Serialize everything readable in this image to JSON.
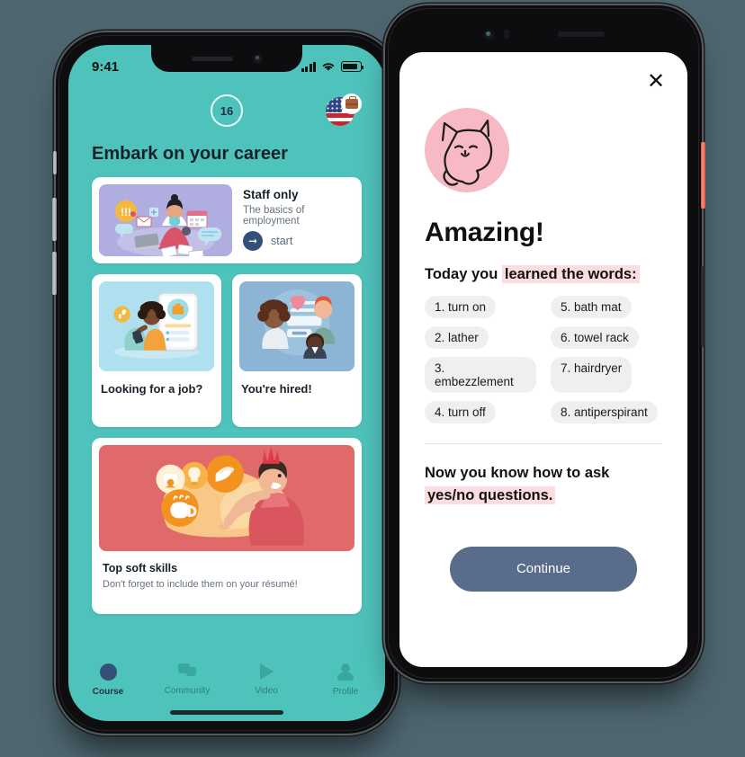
{
  "left_phone": {
    "status_bar": {
      "time": "9:41",
      "signal_icon": "cellular-bars-icon",
      "wifi_icon": "wifi-icon",
      "battery_icon": "battery-icon"
    },
    "header": {
      "streak_count": "16",
      "flag_icon": "us-flag-icon",
      "badge_icon": "briefcase-icon"
    },
    "page_title": "Embark on your career",
    "featured_card": {
      "title": "Staff only",
      "subtitle": "The basics of employment",
      "start_label": "start",
      "start_icon": "arrow-right-icon",
      "thumb_color": "#b0aee0"
    },
    "cards": [
      {
        "title": "Looking for a job?",
        "thumb_color": "#aee0ef"
      },
      {
        "title": "You're hired!",
        "thumb_color": "#8cb4d4"
      }
    ],
    "promo_card": {
      "title": "Top soft skills",
      "subtitle": "Don't forget to include them on your résumé!",
      "thumb_color": "#e06a6a"
    },
    "tabs": [
      {
        "label": "Course",
        "icon": "circle-icon",
        "active": true
      },
      {
        "label": "Community",
        "icon": "chat-bubbles-icon",
        "active": false
      },
      {
        "label": "Video",
        "icon": "play-icon",
        "active": false
      },
      {
        "label": "Profile",
        "icon": "person-icon",
        "active": false
      }
    ],
    "theme": {
      "background": "#4ec3bb",
      "accent": "#33507a",
      "inactive_tab": "#39a6a0"
    }
  },
  "right_phone": {
    "close_icon": "close-icon",
    "avatar_icon": "cat-avatar-icon",
    "heading": "Amazing!",
    "subheading_prefix": "Today you ",
    "subheading_highlight": "learned the words:",
    "words": [
      "1. turn on",
      "2. lather",
      "3. embezzlement",
      "4. turn off",
      "5. bath mat",
      "6. towel rack",
      "7. hairdryer",
      "8. antiperspirant"
    ],
    "footer_line1": "Now you know how to ask",
    "footer_line2": "yes/no questions.",
    "continue_label": "Continue",
    "theme": {
      "highlight": "#fbdde0",
      "button": "#5a6c8c",
      "avatar_bg": "#f7b9c4",
      "chip": "#efefef"
    }
  },
  "page": {
    "background_color": "#4e6670"
  }
}
